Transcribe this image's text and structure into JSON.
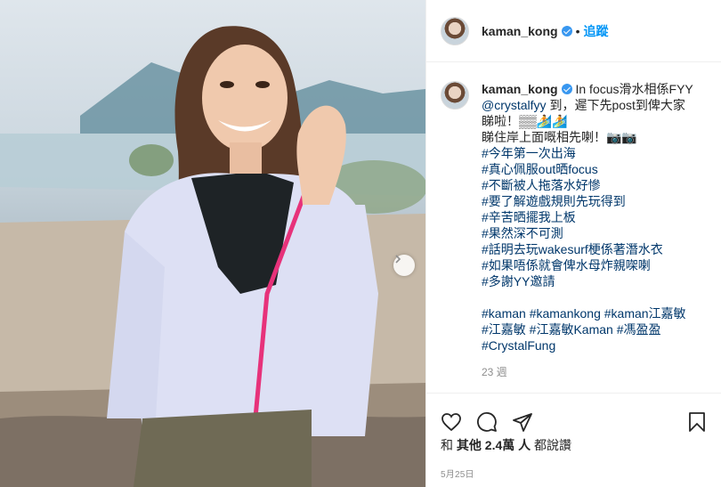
{
  "post": {
    "username": "kaman_kong",
    "follow_label": "追蹤",
    "separator": "•"
  },
  "caption": {
    "line1": "In focus滑水相係FYY",
    "mention": "@crystalfyy",
    "line2": " 到，遲下先post到俾大家",
    "line3": "睇啦！▒▒🏄🏄",
    "line4": "睇住岸上面嘅相先喇！📷📷",
    "hashtags": [
      "#今年第一次出海",
      "#真心佩服out晒focus",
      "#不斷被人拖落水好慘",
      "#要了解遊戲規則先玩得到",
      "#辛苦晒擺我上板",
      "#果然深不可測",
      "#話明去玩wakesurf梗係著潛水衣",
      "#如果唔係就會俾水母炸親㗎喇",
      "#多謝YY邀請"
    ],
    "tags_line1": "#kaman #kamankong #kaman江嘉敏",
    "tags_line2": "#江嘉敏 #江嘉敏Kaman #馮盈盈",
    "tags_line3": "#CrystalFung",
    "time_ago": "23 週"
  },
  "likes": {
    "prefix": "和",
    "others_label": "其他",
    "count": "2.4萬",
    "suffix_person": "人",
    "suffix": "都說讚"
  },
  "date": "5月25日",
  "icons": {
    "like": "heart-icon",
    "comment": "comment-icon",
    "share": "share-icon",
    "save": "bookmark-icon",
    "next": "chevron-right-icon",
    "verified": "verified-badge-icon"
  },
  "colors": {
    "accent": "#0095f6",
    "hashtag": "#00376b",
    "verified": "#3897f0"
  }
}
